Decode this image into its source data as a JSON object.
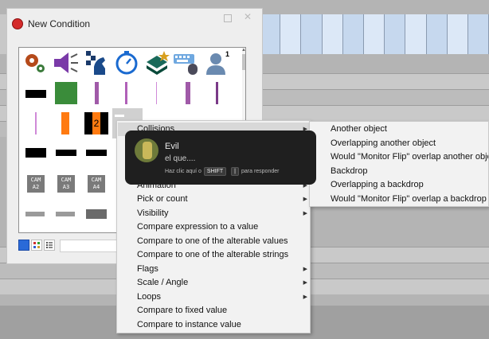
{
  "dialog": {
    "title": "New Condition"
  },
  "object_grid": {
    "icons": [
      "settings-icon",
      "sound-icon",
      "chess-icon",
      "timer-icon",
      "layers-icon",
      "keyboard-mouse-icon",
      "player-icon"
    ],
    "player_number": "1",
    "selected_counter_label": "2",
    "cam_labels": [
      "CAM\nA2",
      "CAM\nA3",
      "CAM\nA4"
    ],
    "colors": {
      "green": "#3a8c3a",
      "purple": "#a05aa8",
      "orange": "#ff7a10",
      "black": "#000000"
    }
  },
  "context_menu": {
    "items": [
      {
        "label": "Collisions",
        "submenu": true
      },
      {
        "label": "Animation",
        "submenu": true
      },
      {
        "label": "Pick or count",
        "submenu": true
      },
      {
        "label": "Visibility",
        "submenu": true
      },
      {
        "label": "Compare expression to a value",
        "submenu": false
      },
      {
        "label": "Compare to one of the alterable values",
        "submenu": false
      },
      {
        "label": "Compare to one of the alterable strings",
        "submenu": false
      },
      {
        "label": "Flags",
        "submenu": true
      },
      {
        "label": "Scale / Angle",
        "submenu": true
      },
      {
        "label": "Loops",
        "submenu": true
      },
      {
        "label": "Compare to fixed value",
        "submenu": false
      },
      {
        "label": "Compare to instance value",
        "submenu": false
      }
    ]
  },
  "collisions_submenu": {
    "items": [
      "Another object",
      "Overlapping another object",
      "Would \"Monitor Flip\" overlap another object",
      "Backdrop",
      "Overlapping a backdrop",
      "Would \"Monitor Flip\" overlap a backdrop at"
    ]
  },
  "toast": {
    "name": "Evil",
    "message": "el que....",
    "hint_prefix": "Haz clic aquí o",
    "key1": "SHIFT",
    "key2": "|",
    "hint_suffix": "para responder"
  }
}
